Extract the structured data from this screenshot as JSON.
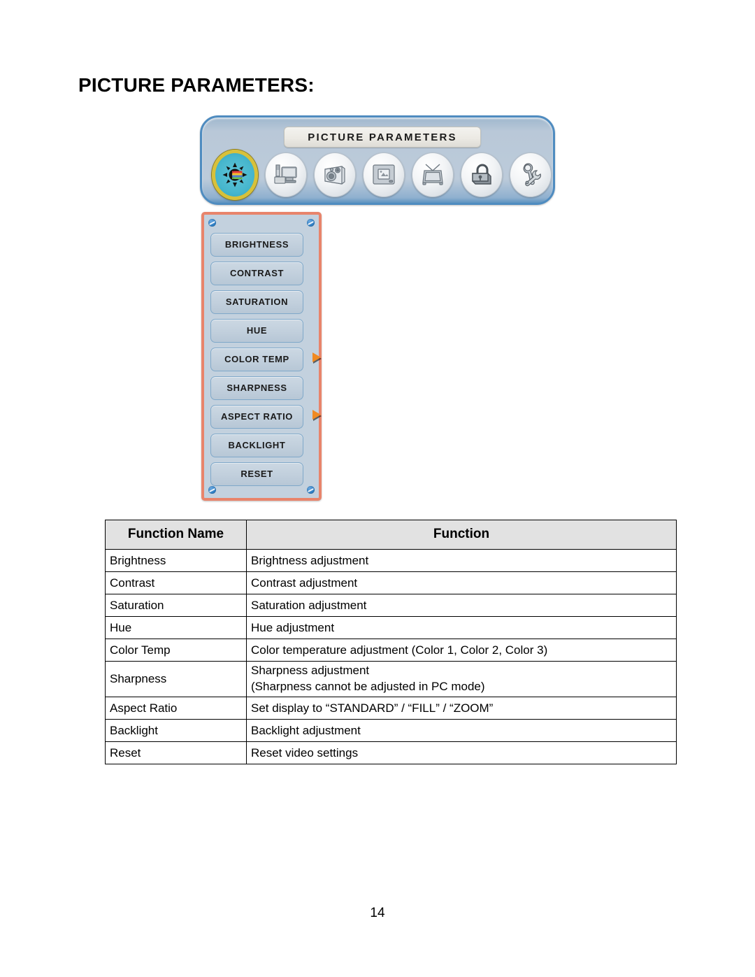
{
  "page": {
    "title": "PICTURE PARAMETERS:",
    "number": "14"
  },
  "osd": {
    "toolbar": {
      "title": "PICTURE PARAMETERS",
      "icons": [
        {
          "name": "picture-icon",
          "selected": true
        },
        {
          "name": "pc-monitor-icon",
          "selected": false
        },
        {
          "name": "audio-speaker-icon",
          "selected": false
        },
        {
          "name": "screen-mode-icon",
          "selected": false
        },
        {
          "name": "tv-tuner-icon",
          "selected": false
        },
        {
          "name": "parental-lock-icon",
          "selected": false
        },
        {
          "name": "setup-tools-icon",
          "selected": false
        }
      ]
    },
    "menu": {
      "items": [
        {
          "label": "BRIGHTNESS",
          "has_submenu": false
        },
        {
          "label": "CONTRAST",
          "has_submenu": false
        },
        {
          "label": "SATURATION",
          "has_submenu": false
        },
        {
          "label": "HUE",
          "has_submenu": false
        },
        {
          "label": "COLOR TEMP",
          "has_submenu": true
        },
        {
          "label": "SHARPNESS",
          "has_submenu": false
        },
        {
          "label": "ASPECT RATIO",
          "has_submenu": true
        },
        {
          "label": "BACKLIGHT",
          "has_submenu": false
        },
        {
          "label": "RESET",
          "has_submenu": false
        }
      ]
    }
  },
  "table": {
    "headers": [
      "Function Name",
      "Function"
    ],
    "rows": [
      {
        "name": "Brightness",
        "function": "Brightness adjustment"
      },
      {
        "name": "Contrast",
        "function": "Contrast adjustment"
      },
      {
        "name": "Saturation",
        "function": "Saturation adjustment"
      },
      {
        "name": "Hue",
        "function": "Hue adjustment"
      },
      {
        "name": "Color Temp",
        "function": "Color temperature adjustment (Color 1, Color 2, Color 3)"
      },
      {
        "name": "Sharpness",
        "function": "Sharpness adjustment\n(Sharpness cannot be adjusted in PC mode)"
      },
      {
        "name": "Aspect Ratio",
        "function": "Set display to “STANDARD” / “FILL” / “ZOOM”"
      },
      {
        "name": "Backlight",
        "function": "Backlight adjustment"
      },
      {
        "name": "Reset",
        "function": "Reset video settings"
      }
    ]
  },
  "colors": {
    "panel_fill": "#bccbda",
    "panel_border": "#4f8cc0",
    "menu_border": "#e8846b",
    "menu_fill": "#c3d1de",
    "button_fill": "#c2d0dd",
    "button_border": "#7fa8c9",
    "arrow": "#f08a22",
    "selected_icon_ring": "#d8c13a",
    "selected_icon_bg": "#46b6cd",
    "table_header_bg": "#e2e2e2"
  }
}
